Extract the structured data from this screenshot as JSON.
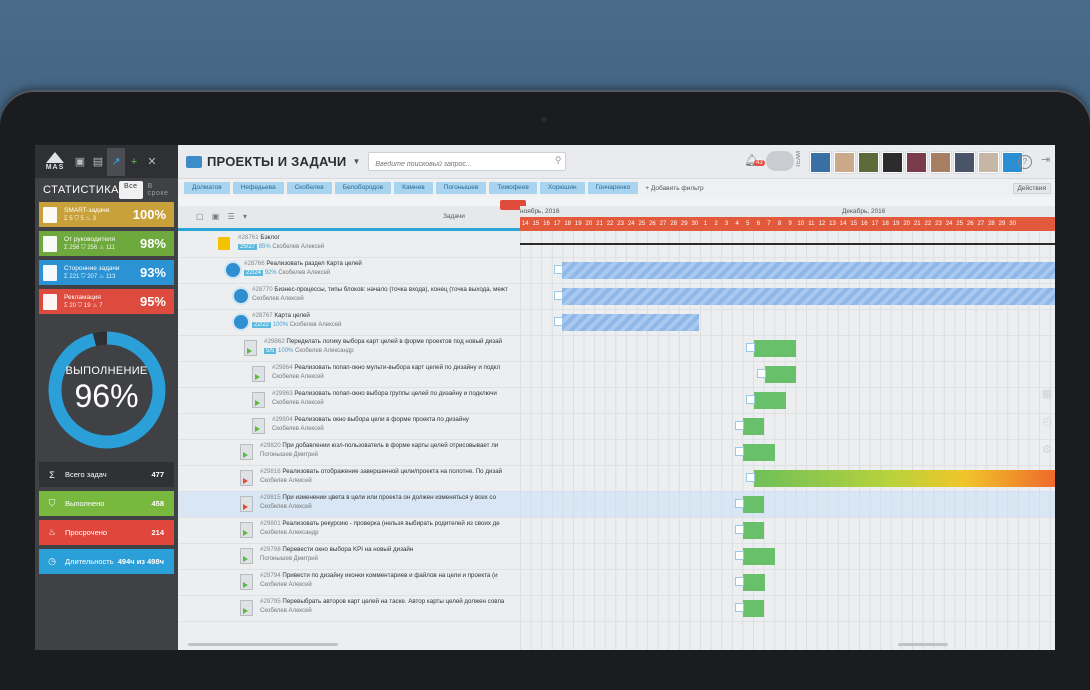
{
  "app": {
    "title": "ПРОЕКТЫ И ЗАДАЧИ",
    "logo_text": "MAS"
  },
  "search": {
    "placeholder": "Введите поисковый запрос..."
  },
  "notifications": {
    "count": "43"
  },
  "team_label": "TEAM",
  "sidebar": {
    "title": "СТАТИСТИКА",
    "filters": [
      "Все",
      "В сроке"
    ],
    "cards": [
      {
        "label": "SMART-задачи",
        "sub": "Σ 5 ⛉ 5 ♨ 3",
        "pct": "100%",
        "color": "#c9a13a"
      },
      {
        "label": "От руководителя",
        "sub": "Σ 256 ⛉ 256 ♨ 111",
        "pct": "98%",
        "color": "#6ea93d"
      },
      {
        "label": "Сторонние задачи",
        "sub": "Σ 221 ⛉ 207 ♨ 113",
        "pct": "93%",
        "color": "#2b92d4"
      },
      {
        "label": "Рекламация",
        "sub": "Σ 20 ⛉ 19 ♨ 7",
        "pct": "95%",
        "color": "#dd4b3e"
      }
    ],
    "ring": {
      "label": "ВЫПОЛНЕНИЕ",
      "value": "96%",
      "fraction": 0.96,
      "color": "#2a9fd8"
    },
    "totals": [
      {
        "label": "Всего задач",
        "value": "477",
        "color": "#2f3134",
        "icon": "Σ"
      },
      {
        "label": "Выполнено",
        "value": "458",
        "color": "#79b83f",
        "icon": "⛉"
      },
      {
        "label": "Просрочено",
        "value": "214",
        "color": "#e0463b",
        "icon": "♨"
      },
      {
        "label": "Длительность",
        "value": "494ч из 498ч",
        "color": "#2a9fd8",
        "icon": "◷"
      }
    ]
  },
  "filters": [
    "Долматов",
    "Нефедьева",
    "Скобелев",
    "Белобородов",
    "Камнев",
    "Погонышев",
    "Тимофеев",
    "Хорюшин",
    "Гончаренко"
  ],
  "add_filter": "+ Добавить фильтр",
  "actions": "Действия",
  "tasks_header": "Задачи",
  "months": [
    "ноябрь, 2016",
    "Декабрь, 2016"
  ],
  "days": [
    "14",
    "15",
    "16",
    "17",
    "18",
    "19",
    "20",
    "21",
    "22",
    "23",
    "24",
    "25",
    "26",
    "27",
    "28",
    "29",
    "30",
    "1",
    "2",
    "3",
    "4",
    "5",
    "6",
    "7",
    "8",
    "9",
    "10",
    "11",
    "12",
    "13",
    "14",
    "15",
    "16",
    "17",
    "18",
    "19",
    "20",
    "21",
    "22",
    "23",
    "24",
    "25",
    "26",
    "27",
    "28",
    "29",
    "30"
  ],
  "rows": [
    {
      "id": "#28761",
      "title": "Бэклог",
      "who": "Скобелев Алексей",
      "prog": "25/27",
      "pct": "85%"
    },
    {
      "id": "#28766",
      "title": "Реализовать раздел Карта целей",
      "who": "Скобелев Алексей",
      "prog": "22/24",
      "pct": "92%"
    },
    {
      "id": "#28770",
      "title": "Бизнес-процессы, типы блоков: начало (точка входа), конец (точка выхода, межт",
      "who": "Скобелев Алексей",
      "prog": "",
      "pct": ""
    },
    {
      "id": "#28767",
      "title": "Карта целей",
      "who": "Скобелев Алексей",
      "prog": "22/22",
      "pct": "100%"
    },
    {
      "id": "#29862",
      "title": "Переделать логику выбора карт целей в форме проектов под новый дизай",
      "who": "Скобелев Александр",
      "prog": "5/5",
      "pct": "100%"
    },
    {
      "id": "#29864",
      "title": "Реализовать попап-окно мульти-выбора карт целей по дизайну и подкл",
      "who": "Скобелев Алексей",
      "prog": "",
      "pct": ""
    },
    {
      "id": "#29863",
      "title": "Реализовать попап-окно выбора группы целей по дизайну и подключи",
      "who": "Скобелев Алексей",
      "prog": "",
      "pct": ""
    },
    {
      "id": "#29804",
      "title": "Реализовать окно выбора цели в форме проекта по дизайну",
      "who": "Скобелев Алексей",
      "prog": "",
      "pct": ""
    },
    {
      "id": "#29820",
      "title": "При добавлении юзл-пользователь в форме карты целей отрисовывает ли",
      "who": "Погонышев Дмитрий",
      "prog": "",
      "pct": ""
    },
    {
      "id": "#29816",
      "title": "Реализовать отображение завершенной цели/проекта на полотне. По дизай",
      "who": "Скобелев Алексей",
      "prog": "",
      "pct": ""
    },
    {
      "id": "#29815",
      "title": "При изменении цвета в цели или проекта он должен изменяться у всех со",
      "who": "Скобелев Алексей",
      "prog": "",
      "pct": ""
    },
    {
      "id": "#29801",
      "title": "Реализовать рекурсию - проверка (нельзя выбирать родителей из своих де",
      "who": "Скобелев Александр",
      "prog": "",
      "pct": ""
    },
    {
      "id": "#29798",
      "title": "Перевести окно выбора KPI на новый дизайн",
      "who": "Погонышев Дмитрий",
      "prog": "",
      "pct": ""
    },
    {
      "id": "#29794",
      "title": "Привести по дизайну иконки комментариев и файлов на цели и проекта (и",
      "who": "Скобелев Алексей",
      "prog": "",
      "pct": ""
    },
    {
      "id": "#29795",
      "title": "Перевыбрать авторов карт целей на таске. Автор карты целей должен совпа",
      "who": "Скобелев Алексей",
      "prog": "",
      "pct": ""
    }
  ]
}
